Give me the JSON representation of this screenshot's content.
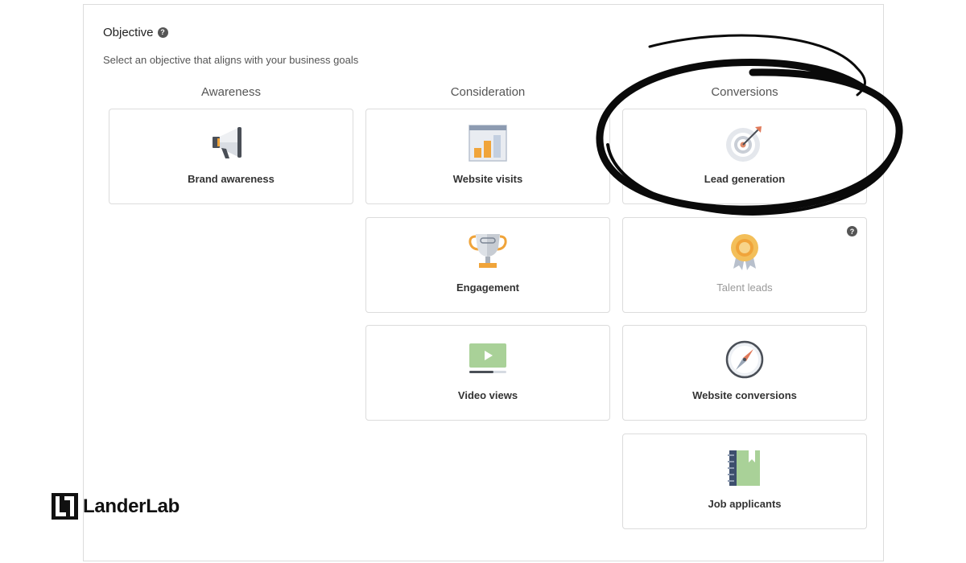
{
  "objective": {
    "title": "Objective",
    "subtitle": "Select an objective that aligns with your business goals"
  },
  "columns": {
    "awareness": "Awareness",
    "consideration": "Consideration",
    "conversions": "Conversions"
  },
  "cards": {
    "brand_awareness": "Brand awareness",
    "website_visits": "Website visits",
    "engagement": "Engagement",
    "video_views": "Video views",
    "lead_generation": "Lead generation",
    "talent_leads": "Talent leads",
    "website_conversions": "Website conversions",
    "job_applicants": "Job applicants"
  },
  "icons": {
    "brand_awareness": "megaphone-icon",
    "website_visits": "bar-chart-browser-icon",
    "engagement": "trophy-icon",
    "video_views": "video-player-icon",
    "lead_generation": "target-icon",
    "talent_leads": "award-ribbon-icon",
    "website_conversions": "compass-icon",
    "job_applicants": "notebook-icon"
  },
  "help_glyph": "?",
  "logo": {
    "text": "LanderLab"
  },
  "colors": {
    "border": "#dcdcdc",
    "orange": "#f0a43a",
    "green": "#8fc27c",
    "navy": "#3d4f6d"
  }
}
